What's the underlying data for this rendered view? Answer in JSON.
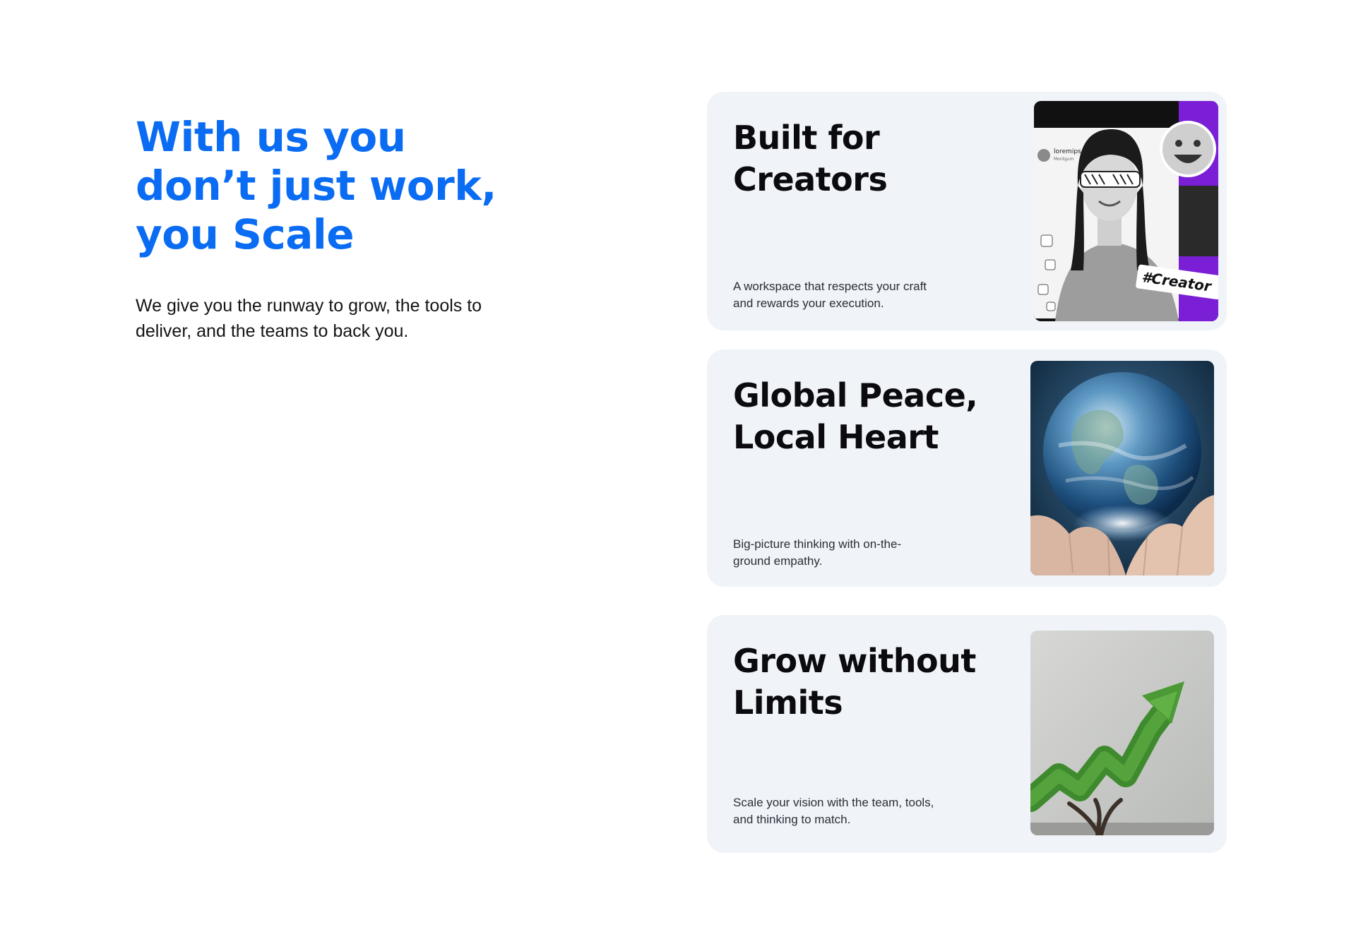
{
  "hero": {
    "title_lines": [
      "With us you",
      "don’t just work,",
      "you Scale"
    ],
    "subtitle_lines": [
      "We give you the runway to grow, the tools to",
      "deliver, and the teams to back you."
    ]
  },
  "cards": [
    {
      "title_lines": [
        "Built for",
        "Creators"
      ],
      "desc_lines": [
        "A workspace that respects your craft",
        "and rewards your execution."
      ],
      "image": {
        "icon": "creator-collage-image",
        "overlay_text": "#Creator",
        "profile_name": "loremips",
        "profile_sub": "Montgum"
      }
    },
    {
      "title_lines": [
        "Global Peace,",
        "Local Heart"
      ],
      "desc_lines": [
        "Big-picture thinking with on-the-",
        "ground empathy."
      ],
      "image": {
        "icon": "earth-in-hands-image"
      }
    },
    {
      "title_lines": [
        "Grow without",
        "Limits"
      ],
      "desc_lines": [
        "Scale your vision with the team, tools,",
        "and thinking to match."
      ],
      "image": {
        "icon": "growth-tree-arrow-image"
      }
    }
  ],
  "colors": {
    "accent": "#0a6cf3",
    "card_bg": "#f0f3f8",
    "text_dark": "#0b0b0f"
  }
}
